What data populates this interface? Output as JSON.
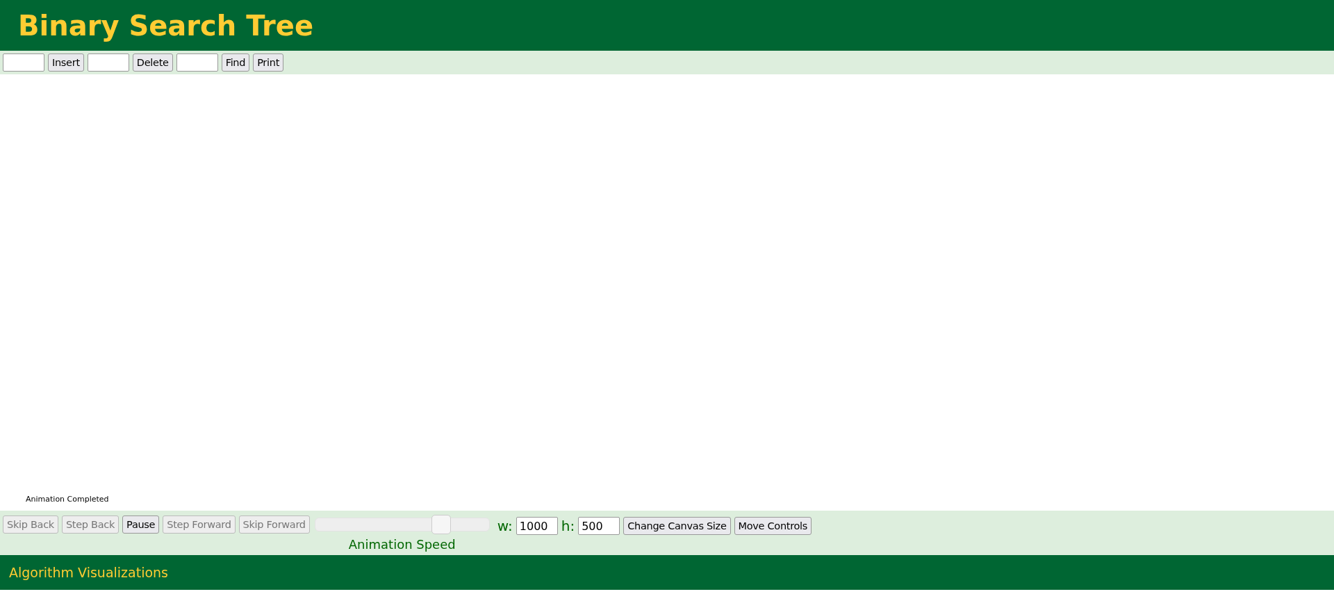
{
  "header": {
    "title": "Binary Search Tree"
  },
  "toolbar": [
    {
      "kind": "field"
    },
    {
      "kind": "button",
      "label": "Insert"
    },
    {
      "kind": "field"
    },
    {
      "kind": "button",
      "label": "Delete"
    },
    {
      "kind": "field"
    },
    {
      "kind": "button",
      "label": "Find"
    },
    {
      "kind": "button",
      "label": "Print"
    }
  ],
  "status": "Animation Completed",
  "playback": [
    {
      "label": "Skip Back",
      "disabled": true
    },
    {
      "label": "Step Back",
      "disabled": true
    },
    {
      "label": "Pause",
      "disabled": false
    },
    {
      "label": "Step Forward",
      "disabled": true
    },
    {
      "label": "Skip Forward",
      "disabled": true
    }
  ],
  "speed": {
    "level": 0.75,
    "label": "Animation Speed"
  },
  "canvas_size": {
    "w_label": "w:",
    "w_value": "1000",
    "h_label": "h:",
    "h_value": "500",
    "buttons": [
      "Change Canvas Size",
      "Move Controls"
    ]
  },
  "footer": "Algorithm Visualizations"
}
